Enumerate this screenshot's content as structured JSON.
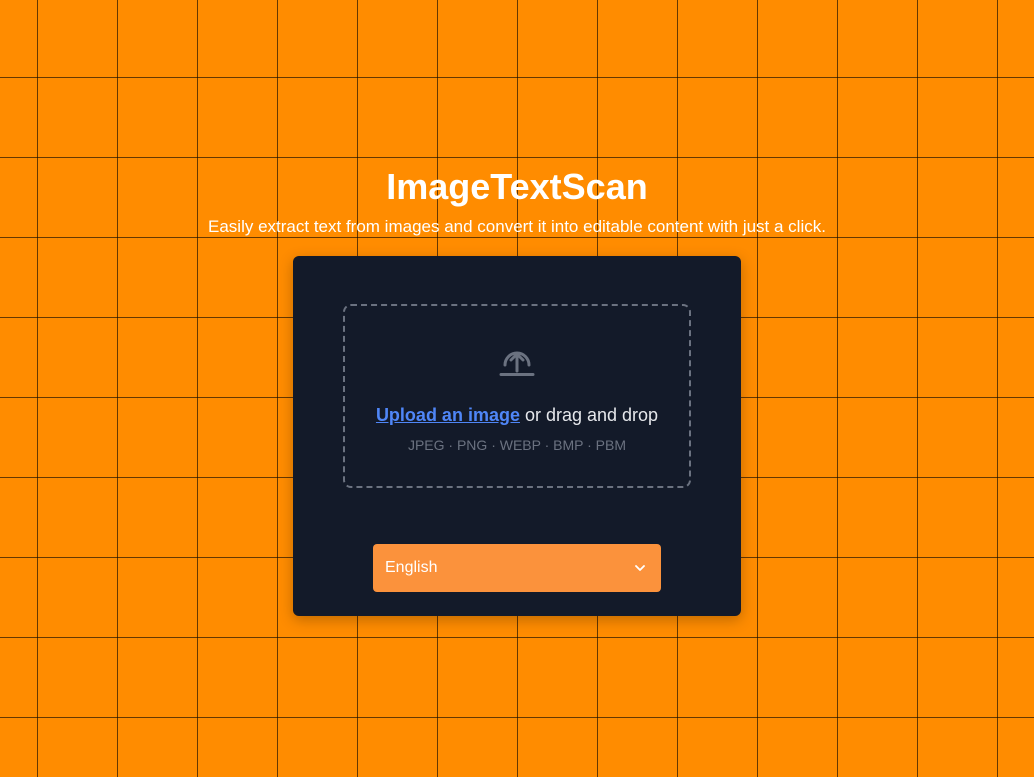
{
  "header": {
    "title": "ImageTextScan",
    "subtitle": "Easily extract text from images and convert it into editable content with just a click."
  },
  "upload": {
    "link_label": "Upload an image",
    "drag_text": " or drag and drop",
    "formats": "JPEG · PNG · WEBP · BMP · PBM",
    "icon": "upload-icon"
  },
  "language": {
    "selected": "English",
    "icon": "chevron-down-icon"
  },
  "colors": {
    "background": "#ff8c00",
    "card": "#131a29",
    "link": "#4f86f7",
    "select": "#fb923c"
  }
}
